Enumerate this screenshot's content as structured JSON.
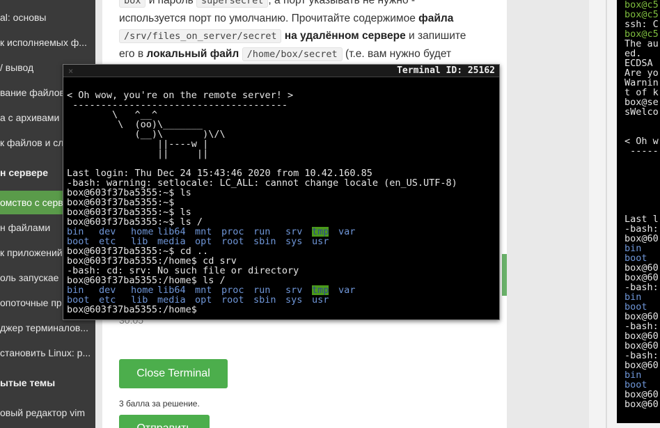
{
  "sidebar": {
    "items": [
      {
        "label": "al: основы",
        "type": "item"
      },
      {
        "label": "к исполняемых ф...",
        "type": "item"
      },
      {
        "label": "/ вывод",
        "type": "item"
      },
      {
        "label": "вание файлов",
        "type": "item"
      },
      {
        "label": "а с архивами",
        "type": "item"
      },
      {
        "label": "к файлов и сло",
        "type": "item"
      },
      {
        "label": "н сервере",
        "type": "section"
      },
      {
        "label": "омство с серве",
        "type": "active"
      },
      {
        "label": "н файлами",
        "type": "item"
      },
      {
        "label": "к приложений",
        "type": "item"
      },
      {
        "label": "оль запускае",
        "type": "item"
      },
      {
        "label": "опоточные пр",
        "type": "item"
      },
      {
        "label": "джер терминалов...",
        "type": "item"
      },
      {
        "label": "становить Linux: р...",
        "type": "item"
      },
      {
        "label": "ытые темы",
        "type": "section"
      },
      {
        "label": "овый редактор vim",
        "type": "item"
      }
    ]
  },
  "lesson": {
    "line0_a": "box",
    "line0_b": "и пароль",
    "line0_c": "supersecret",
    "line0_d": ", а порт указывать не нужно -",
    "line1_a": "используется порт по умолчанию. Прочитайте содержимое",
    "line1_b": "файла",
    "line2_code": "/srv/files_on_server/secret",
    "line2_b": "на удалённом сервере",
    "line2_c": "и запишите",
    "line3_a": "его в",
    "line3_b": "локальный файл",
    "line3_code": "/home/box/secret",
    "line3_c": "(т.е. вам нужно будет",
    "hidden_gray": "30:05",
    "close_terminal": "Close Terminal",
    "points": "3 балла за решение.",
    "submit": "Отправить"
  },
  "terminal": {
    "title": "Terminal ID: 25162",
    "close_glyph": "×",
    "lines": [
      "< Oh wow, you're on the remote server! >",
      " --------------------------------------",
      "        \\   ^__^",
      "         \\  (oo)\\_______",
      "            (__)\\       )\\/\\",
      "                ||----w |",
      "                ||     ||",
      "",
      "Last login: Thu Dec 24 15:43:46 2020 from 10.42.160.85",
      "-bash: warning: setlocale: LC_ALL: cannot change locale (en_US.UTF-8)",
      "box@603f37ba5355:~$ ls",
      "box@603f37ba5355:~$",
      "box@603f37ba5355:~$ ls",
      "box@603f37ba5355:~$ ls /"
    ],
    "ls_row1": [
      "bin",
      "dev",
      "home",
      "lib64",
      "mnt",
      "proc",
      "run",
      "srv",
      "tmp",
      "var"
    ],
    "ls_row2": [
      "boot",
      "etc",
      "lib",
      "media",
      "opt",
      "root",
      "sbin",
      "sys",
      "usr"
    ],
    "lines_after_ls1": [
      "box@603f37ba5355:~$ cd ..",
      "box@603f37ba5355:/home$ cd srv",
      "-bash: cd: srv: No such file or directory",
      "box@603f37ba5355:/home$ ls /"
    ],
    "final_prompt": "box@603f37ba5355:/home$"
  },
  "mini_terminal": {
    "lines": [
      {
        "t": "box@c5",
        "c": "g"
      },
      {
        "t": "box@c5",
        "c": "g"
      },
      {
        "t": "ssh: C",
        "c": ""
      },
      {
        "t": "box@c5",
        "c": "g"
      },
      {
        "t": "The au",
        "c": ""
      },
      {
        "t": "ed.",
        "c": ""
      },
      {
        "t": "ECDSA",
        "c": ""
      },
      {
        "t": "Are yo",
        "c": ""
      },
      {
        "t": "Warnin",
        "c": ""
      },
      {
        "t": "t of k",
        "c": ""
      },
      {
        "t": "box@se",
        "c": ""
      },
      {
        "t": "sWelco",
        "c": ""
      },
      {
        "t": "",
        "c": ""
      },
      {
        "t": "",
        "c": ""
      },
      {
        "t": "< Oh w",
        "c": ""
      },
      {
        "t": " -----",
        "c": ""
      },
      {
        "t": "",
        "c": ""
      },
      {
        "t": "",
        "c": ""
      },
      {
        "t": "",
        "c": ""
      },
      {
        "t": "",
        "c": ""
      },
      {
        "t": "",
        "c": ""
      },
      {
        "t": "",
        "c": ""
      },
      {
        "t": "Last l",
        "c": ""
      },
      {
        "t": "-bash:",
        "c": ""
      },
      {
        "t": "box@60",
        "c": ""
      },
      {
        "t": "bin",
        "c": "b"
      },
      {
        "t": "boot",
        "c": "b"
      },
      {
        "t": "box@60",
        "c": ""
      },
      {
        "t": "box@60",
        "c": ""
      },
      {
        "t": "-bash:",
        "c": ""
      },
      {
        "t": "bin",
        "c": "b"
      },
      {
        "t": "boot",
        "c": "b"
      },
      {
        "t": "box@60",
        "c": ""
      },
      {
        "t": "-bash:",
        "c": ""
      },
      {
        "t": "box@60",
        "c": ""
      },
      {
        "t": "box@60",
        "c": ""
      },
      {
        "t": "-bash:",
        "c": ""
      },
      {
        "t": "box@60",
        "c": ""
      },
      {
        "t": "bin",
        "c": "b"
      },
      {
        "t": "boot",
        "c": "b"
      },
      {
        "t": "box@60",
        "c": ""
      },
      {
        "t": "box@60",
        "c": ""
      }
    ]
  },
  "colors": {
    "accent_green": "#4cae4c",
    "sidebar_bg": "#3a3a3a",
    "terminal_dir_blue": "#6f96d8",
    "terminal_tmp_bg": "#4a9a1a"
  }
}
